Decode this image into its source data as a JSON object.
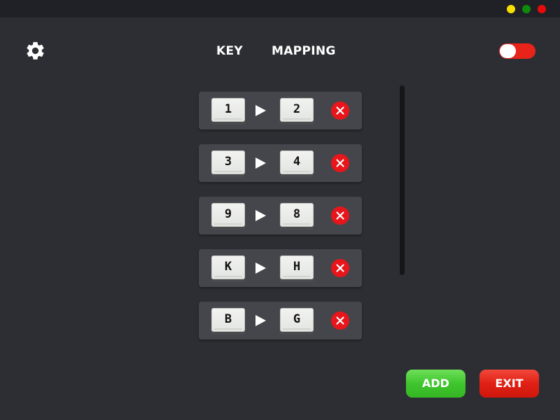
{
  "window": {
    "controls": [
      {
        "name": "minimize",
        "color": "#f5e000"
      },
      {
        "name": "maximize",
        "color": "#108a0a"
      },
      {
        "name": "close",
        "color": "#e80b0b"
      }
    ]
  },
  "header": {
    "settings_icon": "gear-icon",
    "title_left": "KEY",
    "title_right": "MAPPING",
    "toggle": {
      "state": "on",
      "color": "#e8231a"
    }
  },
  "mappings": [
    {
      "from": "1",
      "to": "2"
    },
    {
      "from": "3",
      "to": "4"
    },
    {
      "from": "9",
      "to": "8"
    },
    {
      "from": "K",
      "to": "H"
    },
    {
      "from": "B",
      "to": "G"
    }
  ],
  "row_icons": {
    "arrow": "play-arrow-icon",
    "delete": "close-circle-icon"
  },
  "buttons": {
    "add_label": "ADD",
    "add_color": "#3fc52d",
    "exit_label": "EXIT",
    "exit_color": "#e02014"
  }
}
